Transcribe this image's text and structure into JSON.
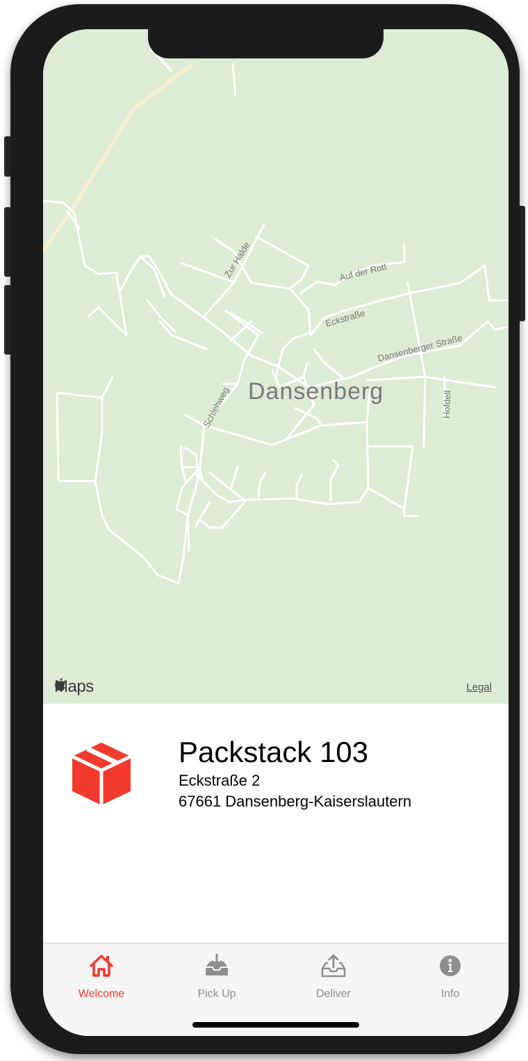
{
  "map": {
    "place_label": "Dansenberg",
    "street_labels": [
      "Zur Halde",
      "Auf der Rott",
      "Eckstraße",
      "Dansenberger Straße",
      "Schlehweg",
      "Hofdell"
    ],
    "brand": "Maps",
    "legal": "Legal"
  },
  "location": {
    "name": "Packstack 103",
    "street": "Eckstraße 2",
    "city": "67661 Dansenberg-Kaiserslautern"
  },
  "tabs": [
    {
      "label": "Welcome",
      "icon": "home-icon",
      "active": true
    },
    {
      "label": "Pick Up",
      "icon": "tray-download-icon",
      "active": false
    },
    {
      "label": "Deliver",
      "icon": "tray-upload-icon",
      "active": false
    },
    {
      "label": "Info",
      "icon": "info-icon",
      "active": false
    }
  ],
  "colors": {
    "accent": "#f23a2e",
    "map_bg": "#dcecd5",
    "inactive": "#8e8e8e"
  }
}
